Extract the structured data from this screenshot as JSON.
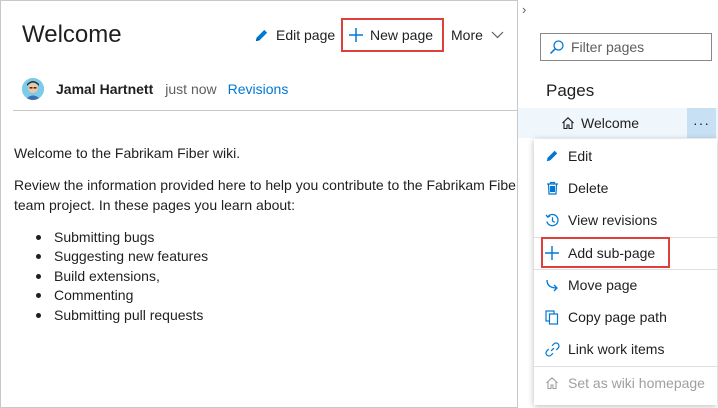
{
  "page": {
    "title": "Welcome",
    "toolbar": {
      "edit_label": "Edit page",
      "new_label": "New page",
      "more_label": "More"
    },
    "author": {
      "name": "Jamal Hartnett",
      "time": "just now",
      "revisions_label": "Revisions"
    },
    "content": {
      "intro": "Welcome to the Fabrikam Fiber wiki.",
      "paragraph_line1": "Review the information provided here to help you contribute to the Fabrikam Fibe",
      "paragraph_line2": "team project. In these pages you learn about:",
      "bullets": [
        "Submitting bugs",
        "Suggesting new features",
        "Build extensions,",
        "Commenting",
        "Submitting pull requests"
      ]
    }
  },
  "pane": {
    "collapse_glyph": "›",
    "filter_placeholder": "Filter pages",
    "heading": "Pages",
    "tree": [
      {
        "label": "Welcome",
        "icon": "home-icon"
      }
    ],
    "more_glyph": "···",
    "menu": [
      {
        "label": "Edit",
        "icon": "pencil-icon",
        "enabled": true
      },
      {
        "label": "Delete",
        "icon": "trash-icon",
        "enabled": true
      },
      {
        "label": "View revisions",
        "icon": "history-icon",
        "enabled": true
      },
      {
        "label": "Add sub-page",
        "icon": "plus-icon",
        "enabled": true,
        "highlighted": true
      },
      {
        "label": "Move page",
        "icon": "move-icon",
        "enabled": true
      },
      {
        "label": "Copy page path",
        "icon": "copy-icon",
        "enabled": true
      },
      {
        "label": "Link work items",
        "icon": "link-icon",
        "enabled": true
      },
      {
        "label": "Set as wiki homepage",
        "icon": "home-icon",
        "enabled": false
      }
    ]
  },
  "colors": {
    "accent": "#0078d4",
    "highlight_border": "#e0403c",
    "selected_row": "#eff6fc",
    "disabled_text": "#a19f9d"
  }
}
